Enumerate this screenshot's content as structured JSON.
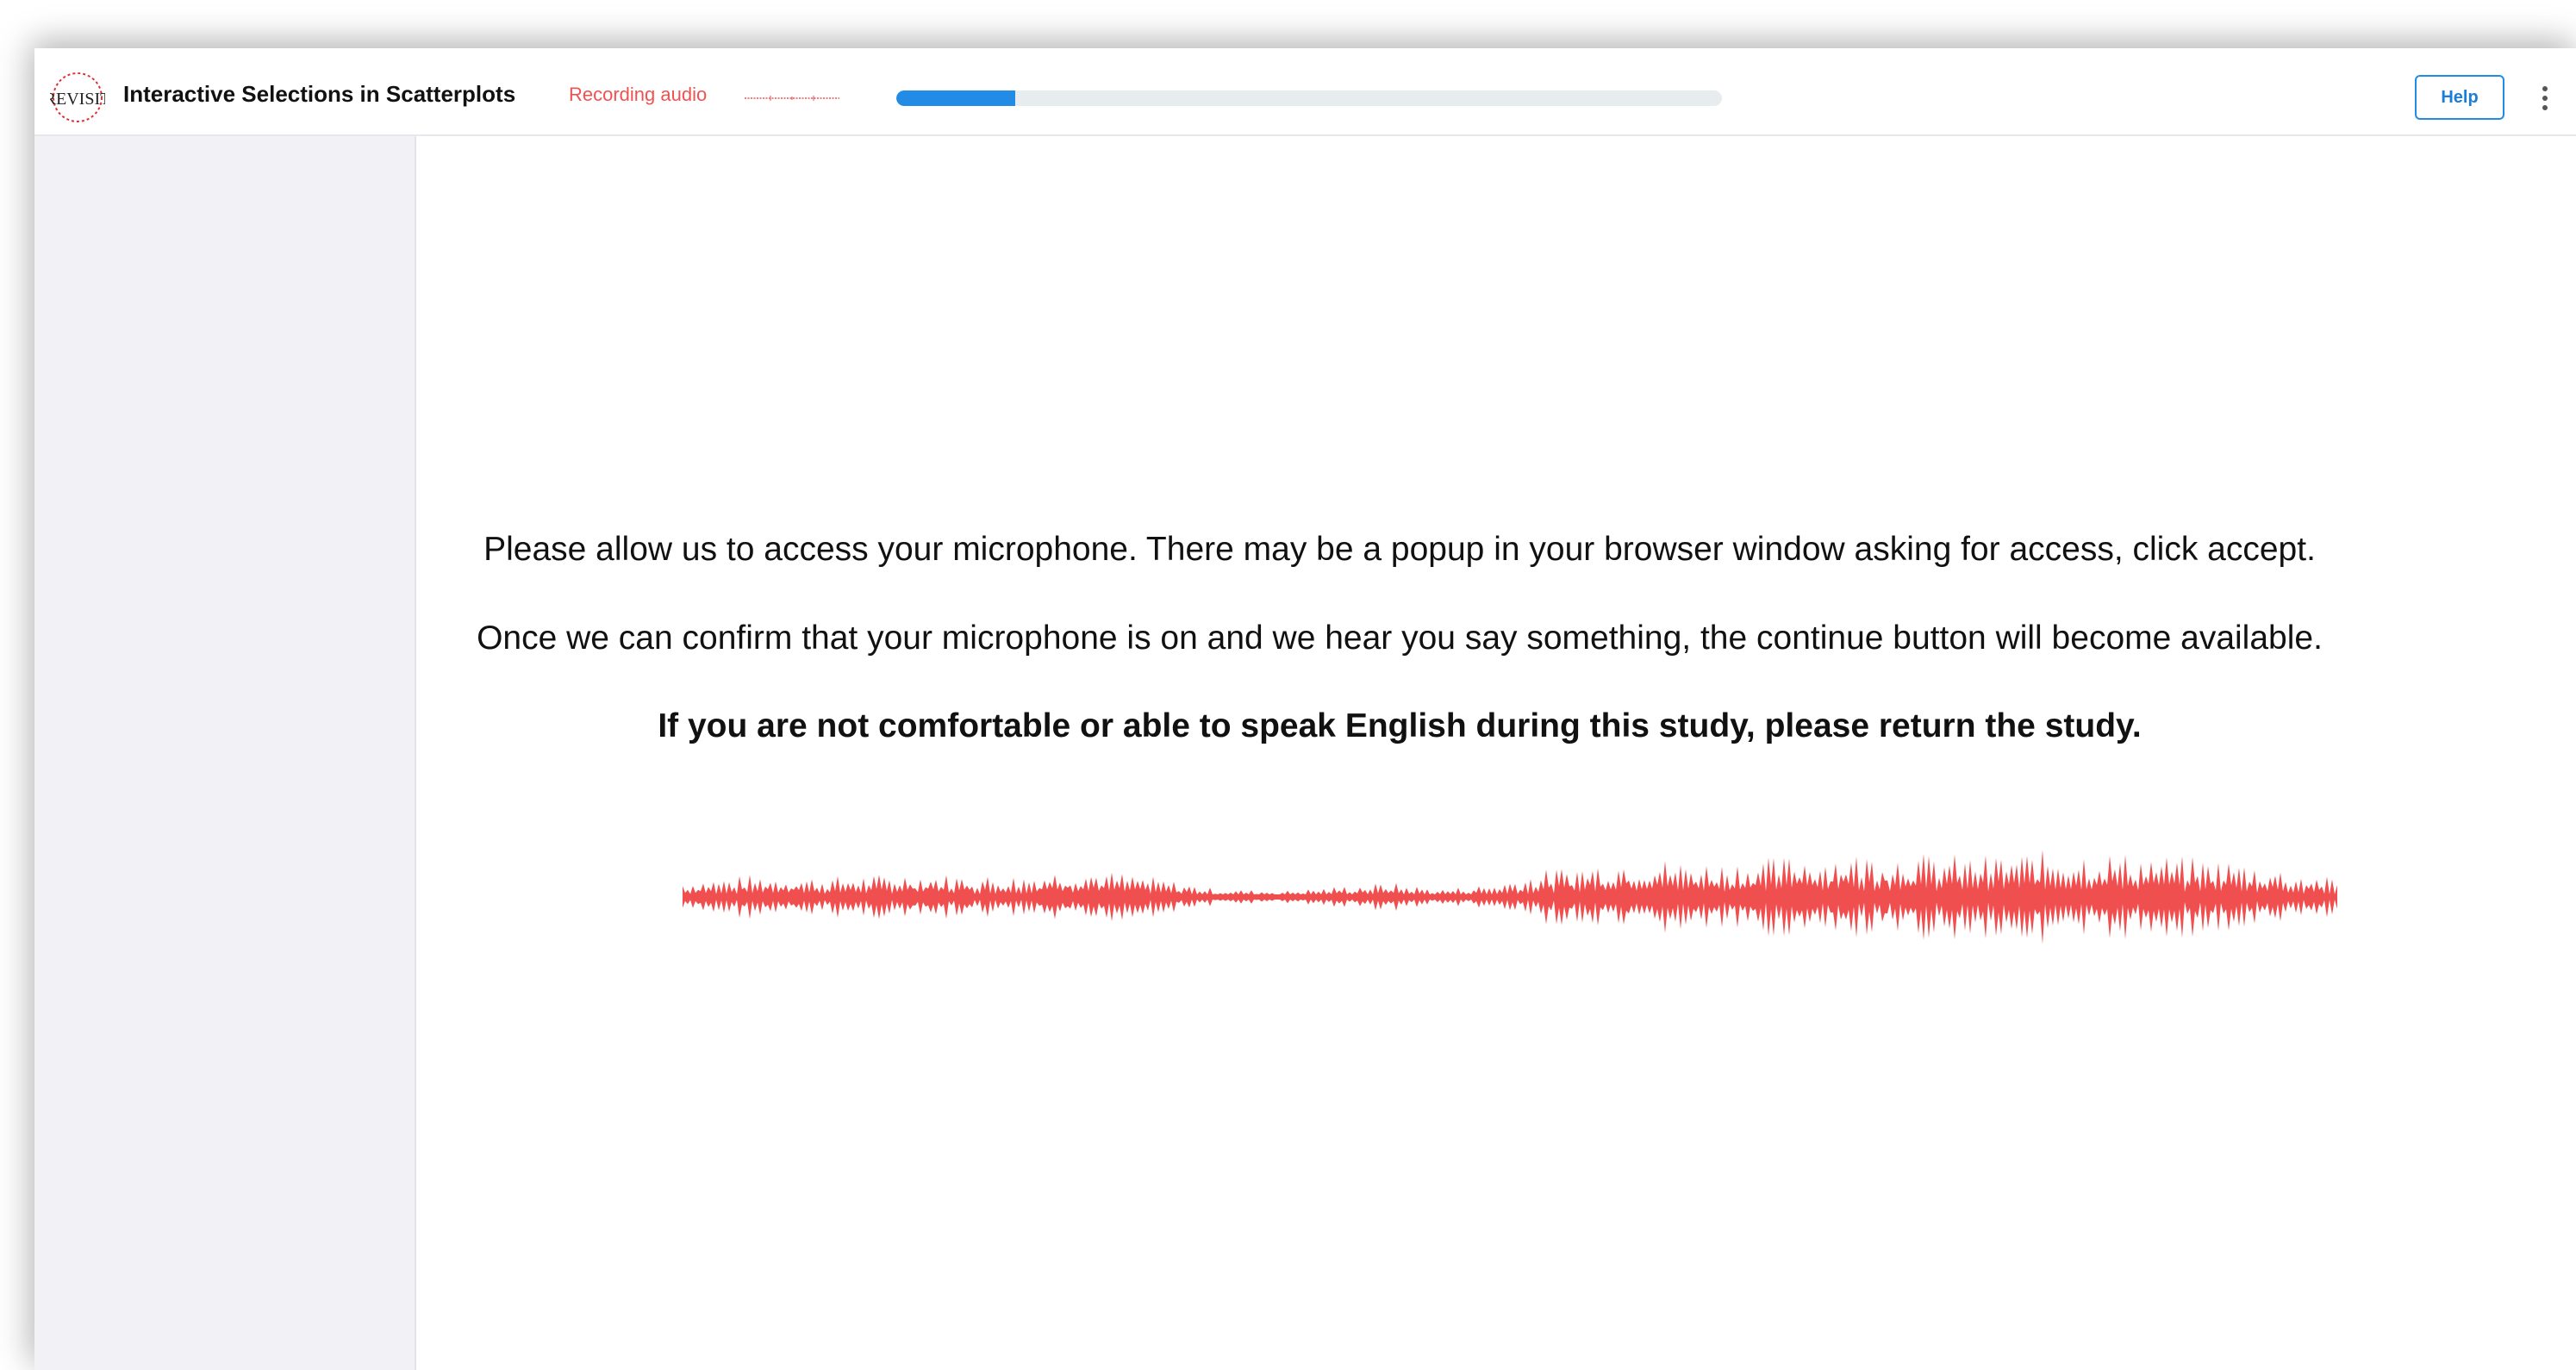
{
  "header": {
    "logo_text": "REVISIT",
    "app_title": "Interactive Selections in Scatterplots",
    "recording_label": "Recording audio",
    "progress_fraction": 0.144,
    "help_label": "Help"
  },
  "main": {
    "paragraph_1": "Please allow us to access your microphone. There may be a popup in your browser window asking for access, click accept.",
    "paragraph_2": "Once we can confirm that your microphone is on and we hear you say something, the continue button will become available.",
    "paragraph_3": "If you are not comfortable or able to speak English during this study, please return the study."
  },
  "colors": {
    "accent": "#228be6",
    "recording": "#f05252",
    "waveform": "#f04f4f",
    "progress_track": "#e7edee",
    "sidebar_bg": "#f1f1f6"
  },
  "icons": {
    "logo": "revisit-logo-icon",
    "menu": "kebab-menu-icon",
    "waveform": "audio-waveform-icon"
  }
}
